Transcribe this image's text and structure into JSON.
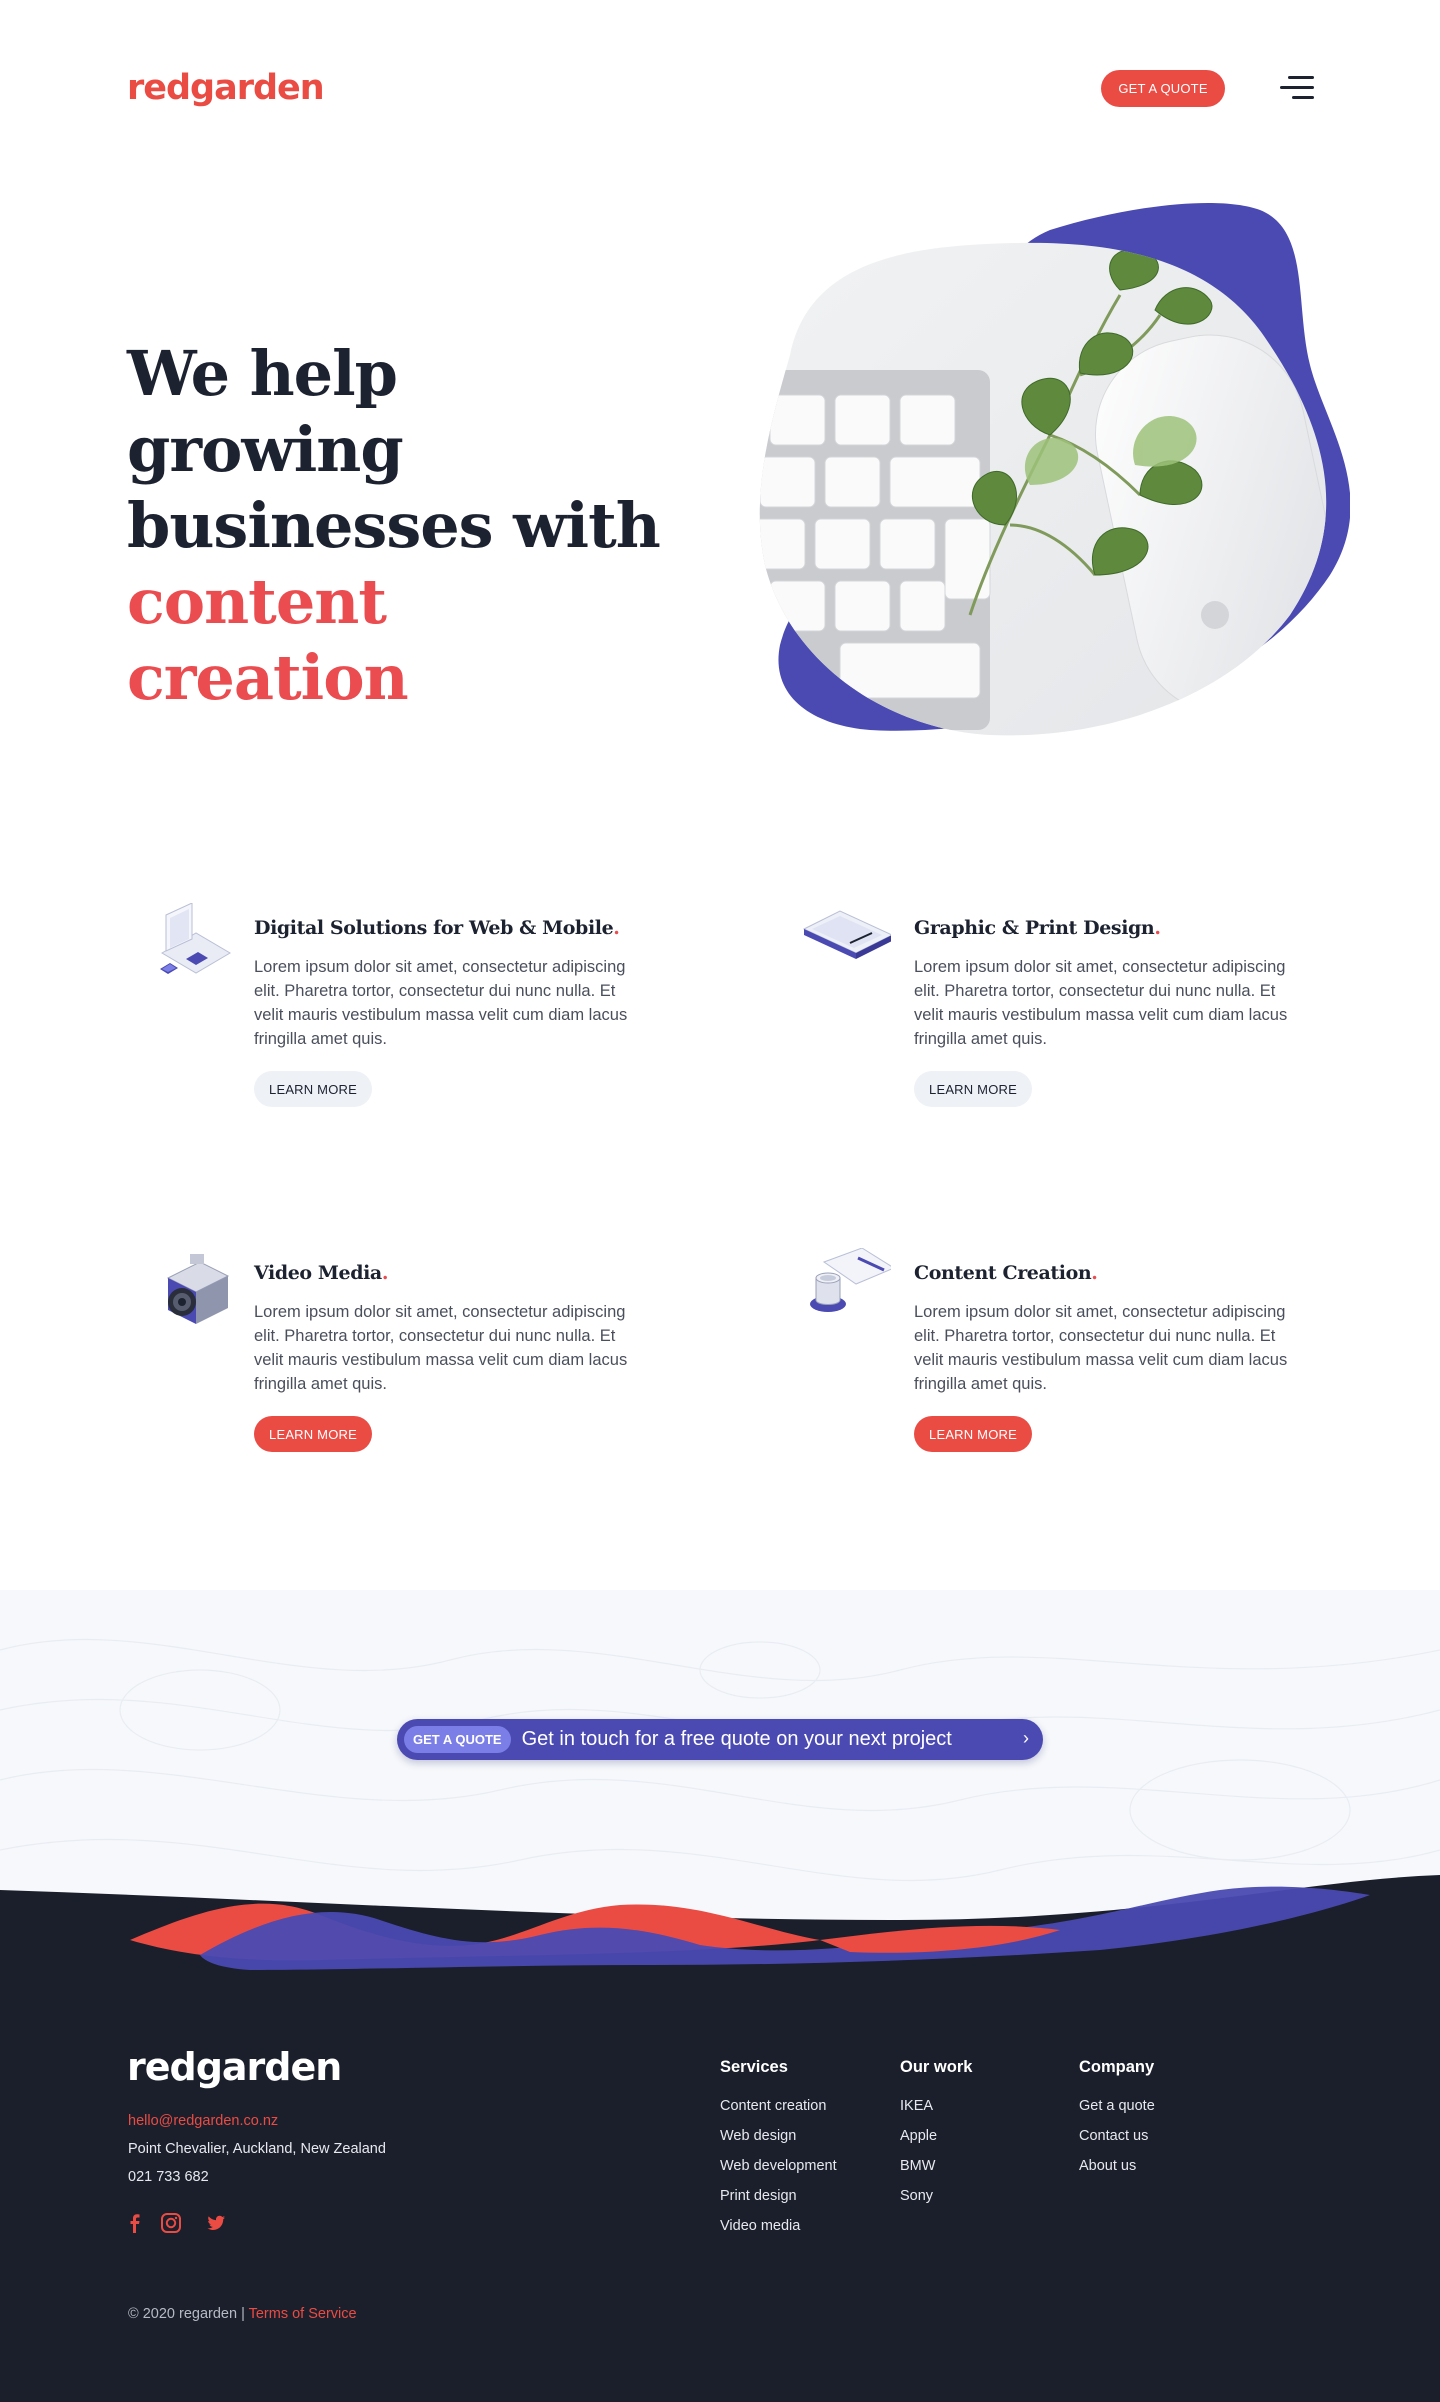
{
  "header": {
    "logo": "redgarden",
    "quote_button": "GET A QUOTE",
    "menu_icon": "hamburger-menu-icon"
  },
  "hero": {
    "title_line1": "We help growing",
    "title_line2": "businesses with",
    "title_accent": "content creation",
    "image": "keyboard-mouse-plant-photo"
  },
  "services": [
    {
      "title": "Digital Solutions for Web & Mobile",
      "dot": ".",
      "description": "Lorem ipsum dolor sit amet, consectetur adipiscing elit. Pharetra tortor, consectetur dui nunc nulla. Et velit mauris vestibulum massa velit cum diam lacus fringilla amet quis.",
      "button": "LEARN MORE",
      "icon": "laptop-phone-icon"
    },
    {
      "title": "Graphic & Print Design",
      "dot": ".",
      "description": "Lorem ipsum dolor sit amet, consectetur adipiscing elit. Pharetra tortor, consectetur dui nunc nulla. Et velit mauris vestibulum massa velit cum diam lacus fringilla amet quis.",
      "button": "LEARN MORE",
      "icon": "tablet-pen-icon"
    },
    {
      "title": "Video Media",
      "dot": ".",
      "description": "Lorem ipsum dolor sit amet, consectetur adipiscing elit. Pharetra tortor, consectetur dui nunc nulla. Et velit mauris vestibulum massa velit cum diam lacus fringilla amet quis.",
      "button": "LEARN MORE",
      "icon": "camera-icon"
    },
    {
      "title": "Content Creation",
      "dot": ".",
      "description": "Lorem ipsum dolor sit amet, consectetur adipiscing elit. Pharetra tortor, consectetur dui nunc nulla. Et velit mauris vestibulum massa velit cum diam lacus fringilla amet quis.",
      "button": "LEARN MORE",
      "icon": "coffee-notebook-icon"
    }
  ],
  "cta": {
    "badge": "GET A QUOTE",
    "text": "Get in touch for a free quote on your next project",
    "arrow": "›"
  },
  "footer": {
    "logo": "redgarden",
    "email": "hello@redgarden.co.nz",
    "address": "Point Chevalier, Auckland, New Zealand",
    "phone": "021 733 682",
    "social": [
      "facebook-icon",
      "instagram-icon",
      "twitter-icon"
    ],
    "columns": [
      {
        "heading": "Services",
        "links": [
          "Content creation",
          "Web design",
          "Web development",
          "Print design",
          "Video media"
        ]
      },
      {
        "heading": "Our work",
        "links": [
          "IKEA",
          "Apple",
          "BMW",
          "Sony"
        ]
      },
      {
        "heading": "Company",
        "links": [
          "Get a quote",
          "Contact us",
          "About us"
        ]
      }
    ],
    "copyright": "© 2020 regarden | ",
    "terms": "Terms of Service"
  },
  "colors": {
    "brand_red": "#ea4c44",
    "brand_indigo": "#4a4ab2",
    "dark": "#1b1f2b"
  }
}
